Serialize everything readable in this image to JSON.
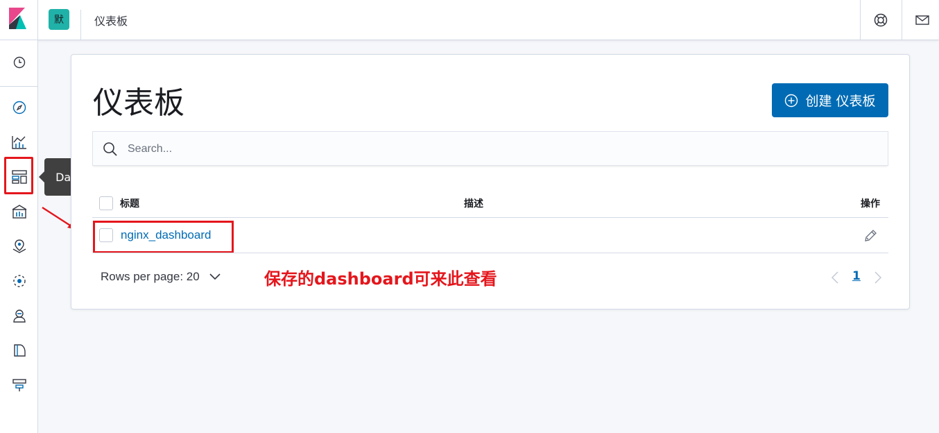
{
  "header": {
    "space_initial": "默",
    "breadcrumb": "仪表板",
    "help_icon": "lifebuoy-icon",
    "mail_icon": "mail-icon"
  },
  "sidebar": {
    "items": [
      {
        "icon": "clock-icon",
        "label": "Recently viewed"
      },
      {
        "icon": "compass-icon",
        "label": "Discover"
      },
      {
        "icon": "visualize-icon",
        "label": "Visualize"
      },
      {
        "icon": "dashboard-icon",
        "label": "Dashboard"
      },
      {
        "icon": "canvas-icon",
        "label": "Canvas"
      },
      {
        "icon": "maps-icon",
        "label": "Maps"
      },
      {
        "icon": "ml-icon",
        "label": "Machine Learning"
      },
      {
        "icon": "infra-icon",
        "label": "Infrastructure"
      },
      {
        "icon": "logs-icon",
        "label": "Logs"
      },
      {
        "icon": "apm-icon",
        "label": "APM"
      }
    ]
  },
  "tooltip": "Dashboard",
  "page": {
    "title": "仪表板",
    "create_button": "创建 仪表板",
    "search_placeholder": "Search..."
  },
  "table": {
    "columns": [
      "标题",
      "描述",
      "操作"
    ],
    "rows": [
      {
        "title": "nginx_dashboard",
        "description": ""
      }
    ]
  },
  "pagination": {
    "rows_per_page": "Rows per page: 20",
    "current_page": "1"
  },
  "annotation": "保存的dashboard可来此查看",
  "colors": {
    "accent": "#006bb4",
    "space_badge": "#20b2a8",
    "annotation_red": "#e4161c"
  }
}
